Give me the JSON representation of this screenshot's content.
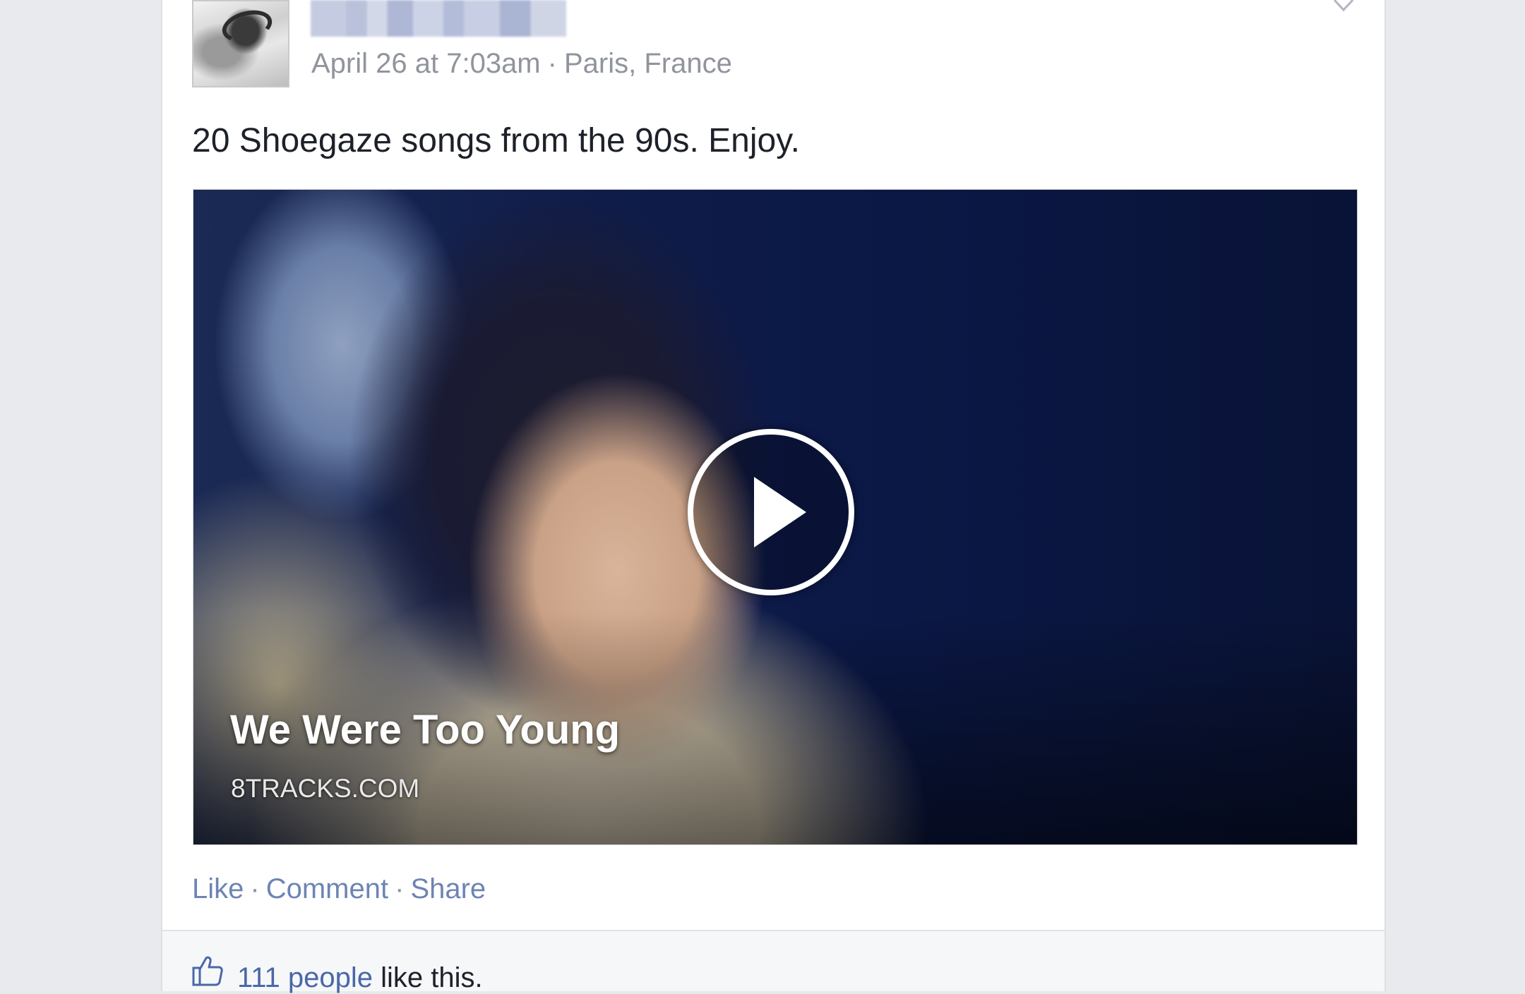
{
  "post": {
    "meta": {
      "date": "April 26 at 7:03am",
      "separator": "·",
      "location": "Paris, France"
    },
    "text": "20 Shoegaze songs from the 90s. Enjoy.",
    "link_preview": {
      "title": "We Were Too Young",
      "source": "8TRACKS.COM"
    },
    "actions": {
      "like": "Like",
      "comment": "Comment",
      "share": "Share",
      "separator": "·"
    },
    "likes": {
      "count_people": "111 people",
      "suffix": " like this."
    }
  },
  "icons": [
    "chevron-down-icon",
    "play-icon",
    "thumbs-up-icon"
  ],
  "colors": {
    "link": "#6d84b4",
    "likes_link": "#4a67a8",
    "meta_text": "#90949c",
    "body_text": "#1d2129",
    "page_bg": "#e9eaed"
  }
}
